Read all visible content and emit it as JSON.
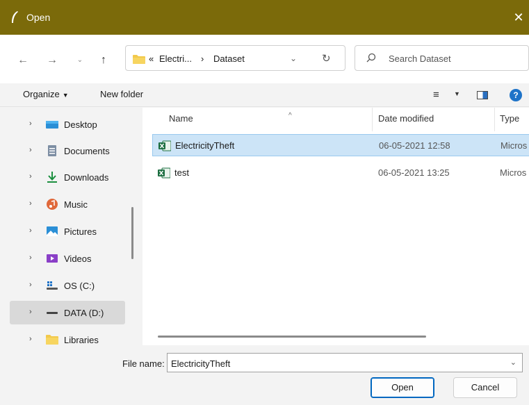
{
  "window": {
    "title": "Open",
    "close_glyph": "✕",
    "titlebar_color": "#7b6a0a"
  },
  "nav": {
    "back": "←",
    "forward": "→",
    "recent": "⌄",
    "up": "↑"
  },
  "address": {
    "segments": [
      "«",
      "Electri...",
      "›",
      "Dataset"
    ],
    "dropdown": "⌄",
    "refresh": "↻"
  },
  "search": {
    "placeholder": "Search Dataset"
  },
  "toolbar": {
    "organize_label": "Organize",
    "organize_caret": "▼",
    "new_folder_label": "New folder",
    "view_glyph": "≡",
    "view_caret": "▼",
    "help_glyph": "?"
  },
  "sidebar": {
    "chevron": "›",
    "items": [
      {
        "label": "Desktop",
        "icon": "desktop-icon"
      },
      {
        "label": "Documents",
        "icon": "documents-icon"
      },
      {
        "label": "Downloads",
        "icon": "downloads-icon"
      },
      {
        "label": "Music",
        "icon": "music-icon"
      },
      {
        "label": "Pictures",
        "icon": "pictures-icon"
      },
      {
        "label": "Videos",
        "icon": "videos-icon"
      },
      {
        "label": "OS (C:)",
        "icon": "drive-c-icon"
      },
      {
        "label": "DATA (D:)",
        "icon": "drive-d-icon",
        "selected": true
      },
      {
        "label": "Libraries",
        "icon": "libraries-icon"
      }
    ]
  },
  "files": {
    "columns": {
      "name": "Name",
      "date": "Date modified",
      "type": "Type",
      "sort_glyph": "^"
    },
    "rows": [
      {
        "name": "ElectricityTheft",
        "date": "06-05-2021 12:58",
        "type": "Micros",
        "selected": true,
        "icon": "excel-icon"
      },
      {
        "name": "test",
        "date": "06-05-2021 13:25",
        "type": "Micros",
        "selected": false,
        "icon": "excel-icon"
      }
    ]
  },
  "footer": {
    "filename_label": "File name:",
    "filename_value": "ElectricityTheft",
    "filename_dropdown": "⌄",
    "open_label": "Open",
    "cancel_label": "Cancel"
  },
  "colors": {
    "accent": "#0067c0",
    "selection": "#cce4f7",
    "excel_green": "#1d6f42",
    "folder_yellow": "#f2c94c"
  }
}
